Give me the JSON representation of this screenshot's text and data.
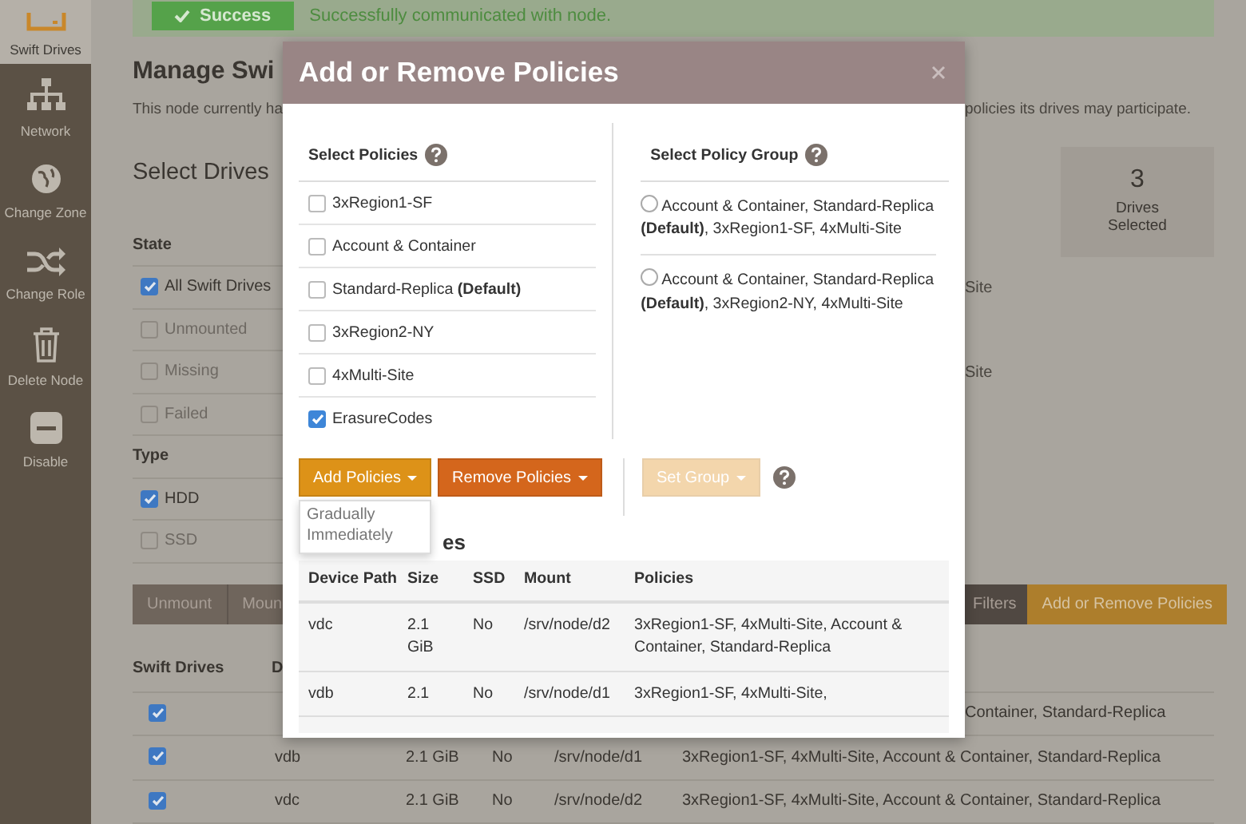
{
  "sidebar": {
    "items": [
      {
        "label": "Swift Drives",
        "selected": true
      },
      {
        "label": "Network",
        "selected": false
      },
      {
        "label": "Change Zone",
        "selected": false
      },
      {
        "label": "Change Role",
        "selected": false
      },
      {
        "label": "Delete Node",
        "selected": false
      },
      {
        "label": "Disable",
        "selected": false
      }
    ]
  },
  "banner": {
    "badge": "Success",
    "message": "Successfully communicated with node."
  },
  "page": {
    "title": "Manage Swi",
    "intro_left": "This node currently ha",
    "intro_right": "policies its drives may participate.",
    "section_title": "Select Drives"
  },
  "drives_selected": {
    "count": "3",
    "label": "Drives Selected"
  },
  "filters": [
    {
      "kind": "header",
      "label": "State"
    },
    {
      "kind": "checkbox",
      "label": "All Swift Drives",
      "checked": true,
      "disabled": false,
      "column_2": "Site"
    },
    {
      "kind": "checkbox",
      "label": "Unmounted",
      "checked": false,
      "disabled": true
    },
    {
      "kind": "checkbox",
      "label": "Missing",
      "checked": false,
      "disabled": true,
      "column_2": "Site"
    },
    {
      "kind": "checkbox",
      "label": "Failed",
      "checked": false,
      "disabled": true
    },
    {
      "kind": "header",
      "label": "Type"
    },
    {
      "kind": "checkbox",
      "label": "HDD",
      "checked": true,
      "disabled": false
    },
    {
      "kind": "checkbox",
      "label": "SSD",
      "checked": false,
      "disabled": true
    }
  ],
  "action_buttons_left": [
    "Unmount",
    "Moun"
  ],
  "action_buttons_right": [
    {
      "label": "Filters",
      "kind": "dark"
    },
    {
      "label": "Add or Remove Policies",
      "kind": "primary"
    }
  ],
  "drives_table": {
    "columns": [
      "Swift Drives",
      "D"
    ],
    "rows": [
      {
        "checked": true,
        "cells": [],
        "tail": "Container, Standard-Replica"
      },
      {
        "checked": true,
        "cells": [
          "",
          "vdb",
          "2.1 GiB",
          "No",
          "/srv/node/d1",
          "3xRegion1-SF, 4xMulti-Site, Account & Container, Standard-Replica"
        ]
      },
      {
        "checked": true,
        "cells": [
          "",
          "vdc",
          "2.1 GiB",
          "No",
          "/srv/node/d2",
          "3xRegion1-SF, 4xMulti-Site, Account & Container, Standard-Replica"
        ]
      }
    ]
  },
  "modal": {
    "title": "Add or Remove Policies",
    "policies_heading": "Select Policies",
    "groups_heading": "Select Policy Group",
    "policies": [
      {
        "label": "3xRegion1-SF",
        "checked": false
      },
      {
        "label": "Account & Container",
        "checked": false
      },
      {
        "label": "Standard-Replica **(Default)**",
        "checked": false
      },
      {
        "label": "3xRegion2-NY",
        "checked": false
      },
      {
        "label": "4xMulti-Site",
        "checked": false
      },
      {
        "label": "ErasureCodes",
        "checked": true
      }
    ],
    "groups": [
      {
        "label": "Account & Container, Standard-Replica **(Default)**, 3xRegion1-SF, 4xMulti-Site",
        "selected": false
      },
      {
        "label": "Account & Container, Standard-Replica **(Default)**, 3xRegion2-NY, 4xMulti-Site",
        "selected": false
      }
    ],
    "buttons": [
      {
        "label": "Add Policies",
        "kind": "add",
        "disabled": false
      },
      {
        "label": "Remove Policies",
        "kind": "remove",
        "disabled": false
      }
    ],
    "group_button": {
      "label": "Set Group",
      "disabled": true
    },
    "add_menu": [
      "Gradually",
      "Immediately"
    ],
    "table_heading": "es",
    "table": {
      "columns": [
        "Device Path",
        "Size",
        "SSD",
        "Mount",
        "Policies"
      ],
      "rows": [
        {
          "cells": [
            "vdc",
            "2.1 GiB",
            "No",
            "/srv/node/d2",
            "3xRegion1-SF, 4xMulti-Site, Account & Container, Standard-Replica"
          ]
        },
        {
          "cells": [
            "vdb",
            "2.1",
            "No",
            "/srv/node/d1",
            "3xRegion1-SF, 4xMulti-Site,"
          ]
        }
      ]
    }
  }
}
